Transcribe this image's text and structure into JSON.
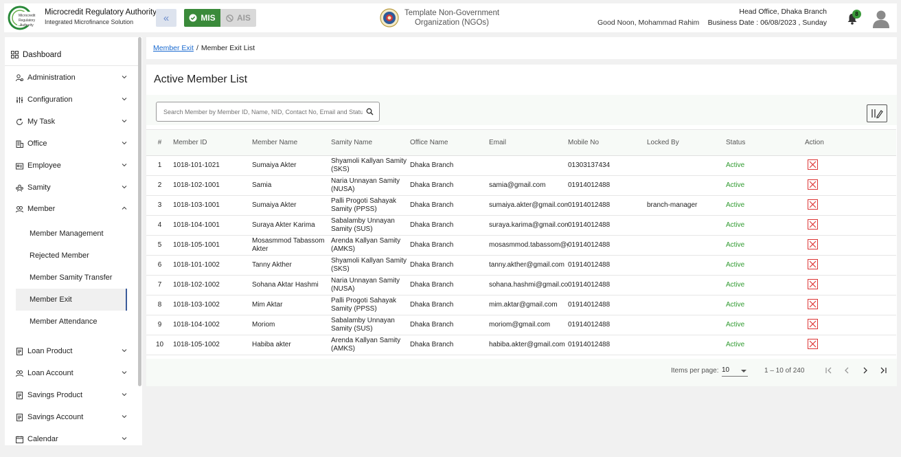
{
  "header": {
    "brand_title": "Microcredit Regulatory Authority",
    "brand_subtitle": "Integrated Microfinance Solution",
    "mis_label": "MIS",
    "ais_label": "AIS",
    "org_name": "Template Non-Government Organization (NGOs)",
    "greeting": "Good Noon, Mohammad Rahim",
    "office": "Head Office, Dhaka Branch",
    "business_date": "Business Date : 06/08/2023 , Sunday",
    "notification_count": "8",
    "colors": {
      "mis": "#3a8a3a",
      "ais": "#d9d9d9",
      "collapse": "#dde3ee"
    }
  },
  "sidebar": {
    "dashboard": "Dashboard",
    "items": [
      {
        "label": "Administration",
        "icon": "users-cog-icon"
      },
      {
        "label": "Configuration",
        "icon": "sliders-icon"
      },
      {
        "label": "My Task",
        "icon": "refresh-icon"
      },
      {
        "label": "Office",
        "icon": "building-icon"
      },
      {
        "label": "Employee",
        "icon": "id-card-icon"
      },
      {
        "label": "Samity",
        "icon": "group-icon"
      },
      {
        "label": "Member",
        "icon": "members-icon"
      }
    ],
    "member_subitems": [
      {
        "label": "Member Management"
      },
      {
        "label": "Rejected Member"
      },
      {
        "label": "Member Samity Transfer"
      },
      {
        "label": "Member Exit"
      },
      {
        "label": "Member Attendance"
      }
    ],
    "items_after": [
      {
        "label": "Loan Product",
        "icon": "document-icon"
      },
      {
        "label": "Loan Account",
        "icon": "members-icon"
      },
      {
        "label": "Savings Product",
        "icon": "document-icon"
      },
      {
        "label": "Savings Account",
        "icon": "document-icon"
      },
      {
        "label": "Calendar",
        "icon": "calendar-icon"
      }
    ]
  },
  "breadcrumb": {
    "link": "Member Exit",
    "separator": "/",
    "current": "Member Exit List"
  },
  "main": {
    "title": "Active Member List",
    "search_placeholder": "Search Member by Member ID, Name, NID, Contact No, Email and Status",
    "columns": [
      "#",
      "Member ID",
      "Member Name",
      "Samity Name",
      "Office Name",
      "Email",
      "Mobile No",
      "Locked By",
      "Status",
      "Action"
    ],
    "rows": [
      {
        "n": "1",
        "id": "1018-101-1021",
        "name": "Sumaiya Akter",
        "samity": "Shyamoli Kallyan Samity (SKS)",
        "office": "Dhaka Branch",
        "email": "",
        "mobile": "01303137434",
        "locked": "",
        "status": "Active"
      },
      {
        "n": "2",
        "id": "1018-102-1001",
        "name": "Samia",
        "samity": "Naria Unnayan Samity (NUSA)",
        "office": "Dhaka Branch",
        "email": "samia@gmail.com",
        "mobile": "01914012488",
        "locked": "",
        "status": "Active"
      },
      {
        "n": "3",
        "id": "1018-103-1001",
        "name": "Sumaiya Akter",
        "samity": "Palli Progoti Sahayak Samity (PPSS)",
        "office": "Dhaka Branch",
        "email": "sumaiya.akter@gmail.com",
        "mobile": "01914012488",
        "locked": "branch-manager",
        "status": "Active"
      },
      {
        "n": "4",
        "id": "1018-104-1001",
        "name": "Suraya Akter Karima",
        "samity": "Sabalamby Unnayan Samity (SUS)",
        "office": "Dhaka Branch",
        "email": "suraya.karima@gmail.com",
        "mobile": "01914012488",
        "locked": "",
        "status": "Active"
      },
      {
        "n": "5",
        "id": "1018-105-1001",
        "name": "Mosasmmod Tabassom Akter",
        "samity": "Arenda Kallyan Samity (AMKS)",
        "office": "Dhaka Branch",
        "email": "mosasmmod.tabassom@gmail.com",
        "mobile": "01914012488",
        "locked": "",
        "status": "Active"
      },
      {
        "n": "6",
        "id": "1018-101-1002",
        "name": "Tanny Akther",
        "samity": "Shyamoli Kallyan Samity (SKS)",
        "office": "Dhaka Branch",
        "email": "tanny.akther@gmail.com",
        "mobile": "01914012488",
        "locked": "",
        "status": "Active"
      },
      {
        "n": "7",
        "id": "1018-102-1002",
        "name": "Sohana Aktar Hashmi",
        "samity": "Naria Unnayan Samity (NUSA)",
        "office": "Dhaka Branch",
        "email": "sohana.hashmi@gmail.com",
        "mobile": "01914012488",
        "locked": "",
        "status": "Active"
      },
      {
        "n": "8",
        "id": "1018-103-1002",
        "name": "Mim Aktar",
        "samity": "Palli Progoti Sahayak Samity (PPSS)",
        "office": "Dhaka Branch",
        "email": "mim.aktar@gmail.com",
        "mobile": "01914012488",
        "locked": "",
        "status": "Active"
      },
      {
        "n": "9",
        "id": "1018-104-1002",
        "name": "Moriom",
        "samity": "Sabalamby Unnayan Samity (SUS)",
        "office": "Dhaka Branch",
        "email": "moriom@gmail.com",
        "mobile": "01914012488",
        "locked": "",
        "status": "Active"
      },
      {
        "n": "10",
        "id": "1018-105-1002",
        "name": "Habiba akter",
        "samity": "Arenda Kallyan Samity (AMKS)",
        "office": "Dhaka Branch",
        "email": "habiba.akter@gmail.com",
        "mobile": "01914012488",
        "locked": "",
        "status": "Active"
      }
    ],
    "status_color": "#2f9a2f",
    "delete_color": "#dd3333"
  },
  "pagination": {
    "items_per_page_label": "Items per page:",
    "items_per_page": "10",
    "range": "1 – 10 of 240"
  }
}
